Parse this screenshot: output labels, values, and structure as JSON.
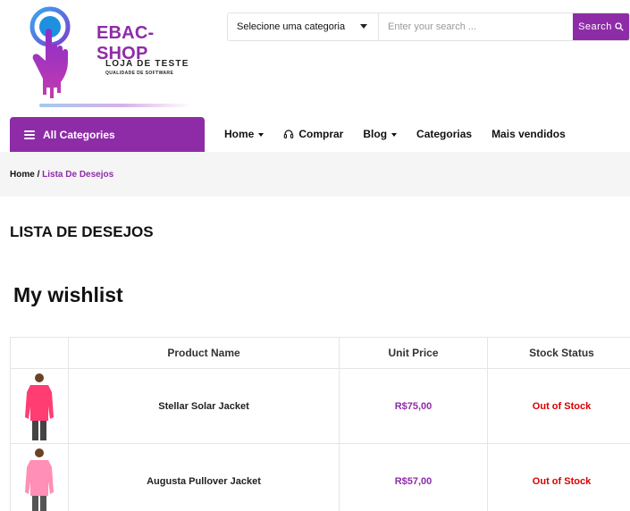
{
  "brand": {
    "name": "EBAC-SHOP",
    "tagline": "LOJA DE TESTE",
    "subtagline": "QUALIDADE DE SOFTWARE"
  },
  "search": {
    "category_label": "Selecione uma categoria",
    "placeholder": "Enter your search ...",
    "button_label": "Search"
  },
  "nav": {
    "all_categories": "All Categories",
    "items": [
      {
        "label": "Home",
        "dropdown": true
      },
      {
        "label": "Comprar",
        "icon": "headphones-icon"
      },
      {
        "label": "Blog",
        "dropdown": true
      },
      {
        "label": "Categorias"
      },
      {
        "label": "Mais vendidos"
      }
    ]
  },
  "breadcrumb": {
    "home": "Home",
    "separator": " / ",
    "current": "Lista De Desejos"
  },
  "page_title": "LISTA DE DESEJOS",
  "wishlist": {
    "title": "My wishlist",
    "columns": [
      "",
      "Product Name",
      "Unit Price",
      "Stock Status"
    ],
    "rows": [
      {
        "product": "Stellar Solar Jacket",
        "price": "R$75,00",
        "stock": "Out of Stock",
        "jacket_color": "#ff3d73"
      },
      {
        "product": "Augusta Pullover Jacket",
        "price": "R$57,00",
        "stock": "Out of Stock",
        "jacket_color": "#ff8fb6"
      }
    ]
  },
  "colors": {
    "accent": "#8e2ca7",
    "stock_out": "#d80000"
  }
}
